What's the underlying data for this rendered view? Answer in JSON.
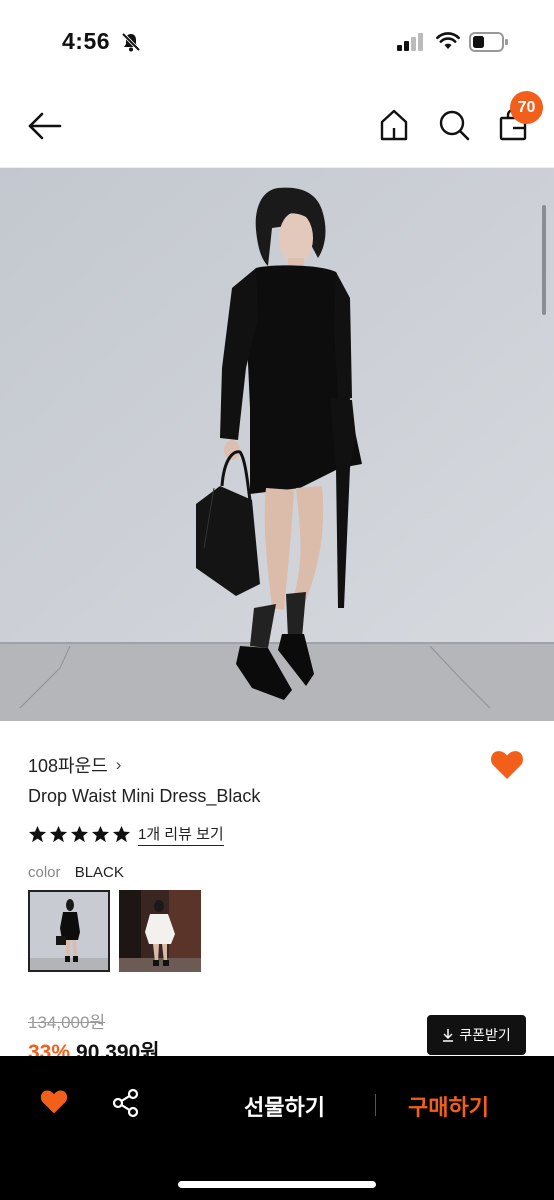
{
  "status_bar": {
    "time": "4:56",
    "icons": [
      "bell-off-icon",
      "cellular-signal-icon",
      "wifi-icon",
      "battery-icon"
    ]
  },
  "nav": {
    "icons": [
      "back-arrow-icon",
      "home-icon",
      "search-icon",
      "shopping-bag-icon"
    ],
    "cart_count": "70"
  },
  "product": {
    "brand": "108파운드",
    "brand_chevron": "›",
    "name": "Drop Waist Mini Dress_Black",
    "rating_stars": 5,
    "review_link": "1개 리뷰 보기",
    "color_label": "color",
    "color_value": "BLACK",
    "original_price": "134,000원",
    "discount": "33%",
    "sale_price": "90,390원",
    "coupon_label": "쿠폰받기",
    "coupon_icon": "download-icon",
    "liked": true
  },
  "bottom_bar": {
    "gift_label": "선물하기",
    "buy_label": "구매하기",
    "icons": [
      "heart-icon",
      "share-icon"
    ]
  },
  "colors": {
    "accent": "#f25f1b",
    "text": "#222222",
    "muted": "#999999",
    "bottom_bar": "#000000"
  }
}
